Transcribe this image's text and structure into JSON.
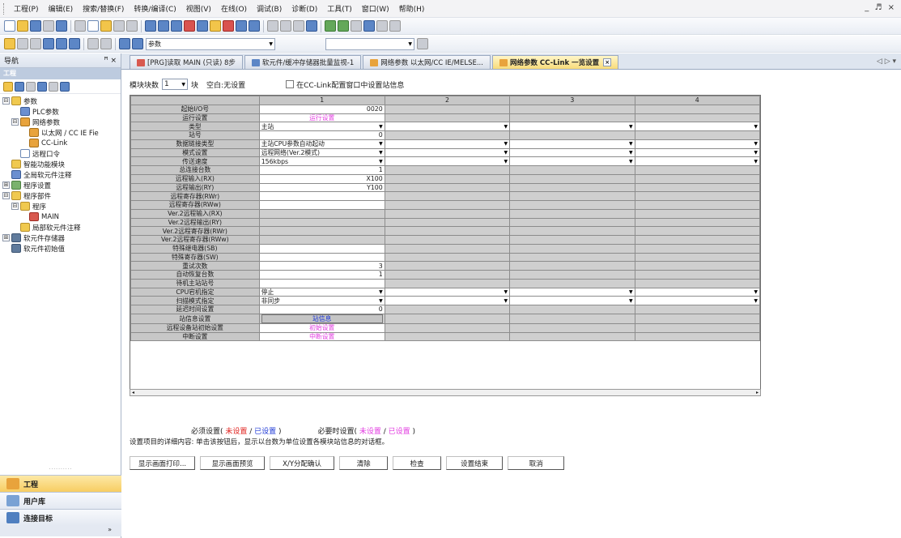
{
  "menu": [
    "工程(P)",
    "编辑(E)",
    "搜索/替换(F)",
    "转换/编译(C)",
    "视图(V)",
    "在线(O)",
    "调试(B)",
    "诊断(D)",
    "工具(T)",
    "窗口(W)",
    "帮助(H)"
  ],
  "window_controls": "_ ♬ ×",
  "toolbar2": {
    "combo_text": "参数"
  },
  "nav": {
    "title": "导航",
    "pin": "ꟸ ×",
    "section": "工程",
    "tree": [
      {
        "label": "参数",
        "indent": 0,
        "expander": "⊟",
        "icon": "folder"
      },
      {
        "label": "PLC参数",
        "indent": 1,
        "expander": "",
        "icon": "param"
      },
      {
        "label": "网络参数",
        "indent": 1,
        "expander": "⊟",
        "icon": "net"
      },
      {
        "label": "以太网 / CC IE Fie",
        "indent": 2,
        "expander": "",
        "icon": "net"
      },
      {
        "label": "CC-Link",
        "indent": 2,
        "expander": "",
        "icon": "net"
      },
      {
        "label": "远程口令",
        "indent": 1,
        "expander": "",
        "icon": "doc"
      },
      {
        "label": "智能功能模块",
        "indent": 0,
        "expander": "",
        "icon": "folder"
      },
      {
        "label": "全局软元件注释",
        "indent": 0,
        "expander": "",
        "icon": "param"
      },
      {
        "label": "程序设置",
        "indent": 0,
        "expander": "⊞",
        "icon": "prog"
      },
      {
        "label": "程序部件",
        "indent": 0,
        "expander": "⊟",
        "icon": "folder"
      },
      {
        "label": "程序",
        "indent": 1,
        "expander": "⊟",
        "icon": "folder"
      },
      {
        "label": "MAIN",
        "indent": 2,
        "expander": "",
        "icon": "red"
      },
      {
        "label": "局部软元件注释",
        "indent": 1,
        "expander": "",
        "icon": "folder"
      },
      {
        "label": "软元件存储器",
        "indent": 0,
        "expander": "⊞",
        "icon": "mem"
      },
      {
        "label": "软元件初始值",
        "indent": 0,
        "expander": "",
        "icon": "mem"
      }
    ],
    "bottom": [
      {
        "label": "工程",
        "active": true
      },
      {
        "label": "用户库",
        "active": false
      },
      {
        "label": "连接目标",
        "active": false
      }
    ],
    "collapse_glyph": "»"
  },
  "tabs": [
    {
      "label": "[PRG]读取 MAIN (只读) 8步",
      "active": false
    },
    {
      "label": "软元件/缓冲存储器批量监视-1",
      "active": false
    },
    {
      "label": "网络参数 以太网/CC IE/MELSE...",
      "active": false
    },
    {
      "label": "网络参数 CC-Link 一览设置",
      "active": true,
      "close": "×"
    }
  ],
  "tab_scroll": "◁ ▷ ▾",
  "top_controls": {
    "module_count_label": "模块块数",
    "module_count_value": "1",
    "unit": "块",
    "empty_label": "空白:无设置",
    "checkbox_label": "在CC-Link配置窗口中设置站信息"
  },
  "grid": {
    "columns": [
      "1",
      "2",
      "3",
      "4"
    ],
    "rows": [
      {
        "label": "起始I/O号",
        "c1": {
          "t": "num",
          "v": "0020"
        },
        "rest": "g"
      },
      {
        "label": "运行设置",
        "c1": {
          "t": "mag",
          "v": "运行设置"
        },
        "rest": "g"
      },
      {
        "label": "类型",
        "c1": {
          "t": "dd",
          "v": "主站"
        },
        "rest": "dd"
      },
      {
        "label": "站号",
        "c1": {
          "t": "num",
          "v": "0"
        },
        "rest": "g"
      },
      {
        "label": "数据链接类型",
        "c1": {
          "t": "dd",
          "v": "主站CPU参数自动起动"
        },
        "rest": "dd"
      },
      {
        "label": "模式设置",
        "c1": {
          "t": "dd",
          "v": "远程网络(Ver.2模式)"
        },
        "rest": "dd"
      },
      {
        "label": "传送速度",
        "c1": {
          "t": "dd",
          "v": "156kbps"
        },
        "rest": "dd"
      },
      {
        "label": "总连接台数",
        "c1": {
          "t": "num",
          "v": "1"
        },
        "rest": "g"
      },
      {
        "label": "远程输入(RX)",
        "c1": {
          "t": "num",
          "v": "X100"
        },
        "rest": "g"
      },
      {
        "label": "远程输出(RY)",
        "c1": {
          "t": "num",
          "v": "Y100"
        },
        "rest": "g"
      },
      {
        "label": "远程寄存器(RWr)",
        "c1": {
          "t": "num",
          "v": ""
        },
        "rest": "g"
      },
      {
        "label": "远程寄存器(RWw)",
        "c1": {
          "t": "num",
          "v": ""
        },
        "rest": "g"
      },
      {
        "label": "Ver.2远程输入(RX)",
        "c1": {
          "t": "gray",
          "v": ""
        },
        "rest": "g"
      },
      {
        "label": "Ver.2远程输出(RY)",
        "c1": {
          "t": "gray",
          "v": ""
        },
        "rest": "g"
      },
      {
        "label": "Ver.2远程寄存器(RWr)",
        "c1": {
          "t": "gray",
          "v": ""
        },
        "rest": "g"
      },
      {
        "label": "Ver.2远程寄存器(RWw)",
        "c1": {
          "t": "gray",
          "v": ""
        },
        "rest": "g"
      },
      {
        "label": "特殊继电器(SB)",
        "c1": {
          "t": "num",
          "v": ""
        },
        "rest": "g"
      },
      {
        "label": "特殊寄存器(SW)",
        "c1": {
          "t": "num",
          "v": ""
        },
        "rest": "g"
      },
      {
        "label": "重试次数",
        "c1": {
          "t": "num",
          "v": "3"
        },
        "rest": "g"
      },
      {
        "label": "自动恢复台数",
        "c1": {
          "t": "num",
          "v": "1"
        },
        "rest": "g"
      },
      {
        "label": "待机主站站号",
        "c1": {
          "t": "num",
          "v": ""
        },
        "rest": "g"
      },
      {
        "label": "CPU宕机指定",
        "c1": {
          "t": "dd",
          "v": "停止"
        },
        "rest": "dd"
      },
      {
        "label": "扫描模式指定",
        "c1": {
          "t": "dd",
          "v": "非同步"
        },
        "rest": "dd"
      },
      {
        "label": "延迟时间设置",
        "c1": {
          "t": "num",
          "v": "0"
        },
        "rest": "g"
      },
      {
        "label": "站信息设置",
        "c1": {
          "t": "btn",
          "v": "站信息"
        },
        "rest": "g"
      },
      {
        "label": "远程设备站初始设置",
        "c1": {
          "t": "mag",
          "v": "初始设置"
        },
        "rest": "g"
      },
      {
        "label": "中断设置",
        "c1": {
          "t": "mag",
          "v": "中断设置"
        },
        "rest": "g"
      }
    ]
  },
  "scroll_arrows": {
    "left": "◂",
    "right": "▸"
  },
  "legend": {
    "required_label": "必须设置(",
    "unset": "未设置",
    "slash": " / ",
    "set": "已设置",
    "close": " )",
    "optional_label": "必要时设置(",
    "optional_unset": "未设置",
    "optional_slash": " / ",
    "optional_set": "已设置",
    "optional_close": " )"
  },
  "hint": "设置项目的详细内容:  单击该按钮后，显示以台数为单位设置各模块站信息的对话框。",
  "buttons": [
    "显示画面打印...",
    "显示画面预览",
    "X/Y分配确认",
    "清除",
    "检查",
    "设置结束",
    "取消"
  ],
  "colors": {
    "magenta": "#e23be0",
    "red": "#e0201c",
    "blue": "#1e38d6",
    "tab_active": "#f8db7a"
  }
}
